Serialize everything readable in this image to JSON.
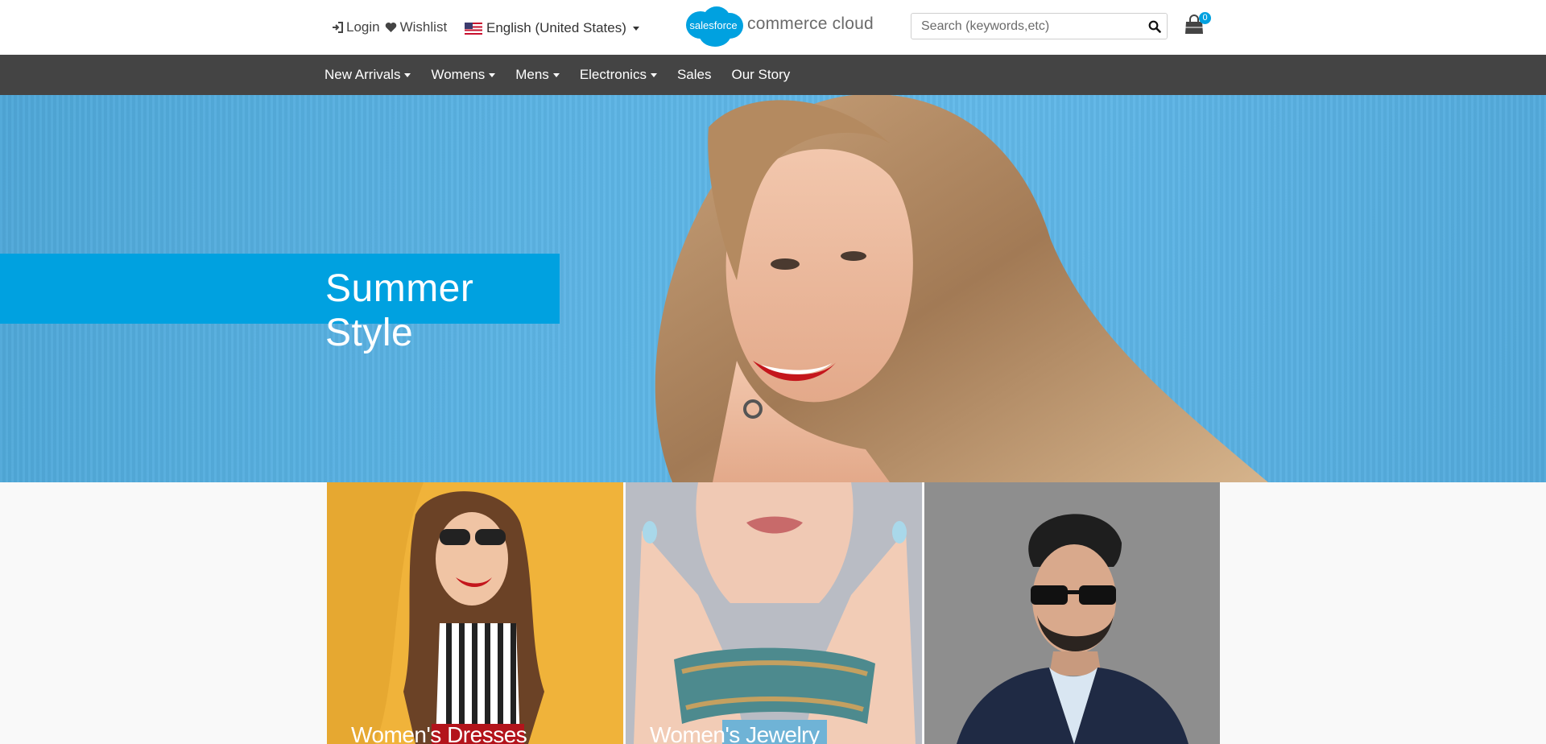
{
  "header": {
    "login_label": "Login",
    "wishlist_label": "Wishlist",
    "locale_label": "English (United States)",
    "logo_badge_text": "salesforce",
    "logo_text": "commerce cloud",
    "search_placeholder": "Search (keywords,etc)",
    "cart_count": "0"
  },
  "nav": {
    "items": [
      {
        "label": "New Arrivals",
        "dropdown": true
      },
      {
        "label": "Womens",
        "dropdown": true
      },
      {
        "label": "Mens",
        "dropdown": true
      },
      {
        "label": "Electronics",
        "dropdown": true
      },
      {
        "label": "Sales",
        "dropdown": false
      },
      {
        "label": "Our Story",
        "dropdown": false
      }
    ]
  },
  "hero": {
    "title": "Summer Style"
  },
  "tiles": [
    {
      "label": "Women's Dresses"
    },
    {
      "label": "Women's Jewelry"
    },
    {
      "label": ""
    }
  ],
  "colors": {
    "accent": "#00a1e0",
    "nav_bg": "#444444",
    "page_bg": "#f9f9f9"
  },
  "icons": [
    "tools-icon",
    "login-icon",
    "heart-icon",
    "us-flag-icon",
    "search-icon",
    "shopping-bag-icon"
  ]
}
